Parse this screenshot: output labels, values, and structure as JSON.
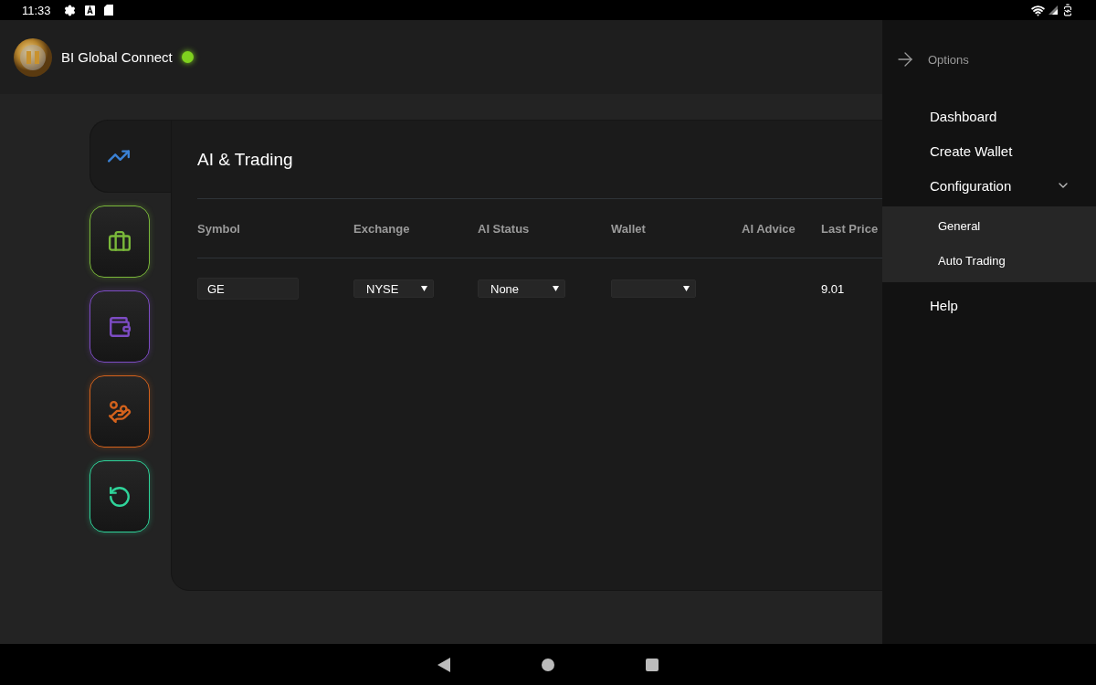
{
  "status_bar": {
    "time": "11:33"
  },
  "header": {
    "title": "BI Global Connect",
    "connected": true
  },
  "side_tabs": [
    {
      "kind": "trend",
      "selected": true,
      "color": "#3b82d6"
    },
    {
      "kind": "briefcase",
      "selected": false,
      "color": "#7ab83a"
    },
    {
      "kind": "wallet",
      "selected": false,
      "color": "#7d4cc4"
    },
    {
      "kind": "payout",
      "selected": false,
      "color": "#d4621c"
    },
    {
      "kind": "refresh",
      "selected": false,
      "color": "#2fd49a"
    }
  ],
  "panel": {
    "title": "AI & Trading",
    "columns": [
      "Symbol",
      "Exchange",
      "AI Status",
      "Wallet",
      "AI Advice",
      "Last Price"
    ],
    "rows": [
      {
        "cells": [
          {
            "kind": "input",
            "value": "GE"
          },
          {
            "kind": "select",
            "value": "NYSE"
          },
          {
            "kind": "select",
            "value": "None"
          },
          {
            "kind": "select"
          },
          {
            "kind": "empty"
          },
          {
            "kind": "text",
            "value": "9.01"
          }
        ]
      }
    ]
  },
  "drawer": {
    "title": "Options",
    "items": [
      {
        "label": "Dashboard"
      },
      {
        "label": "Create Wallet"
      },
      {
        "label": "Configuration",
        "expanded": true,
        "children": [
          {
            "label": "General"
          },
          {
            "label": "Auto Trading"
          }
        ]
      },
      {
        "label": "Help"
      }
    ]
  }
}
